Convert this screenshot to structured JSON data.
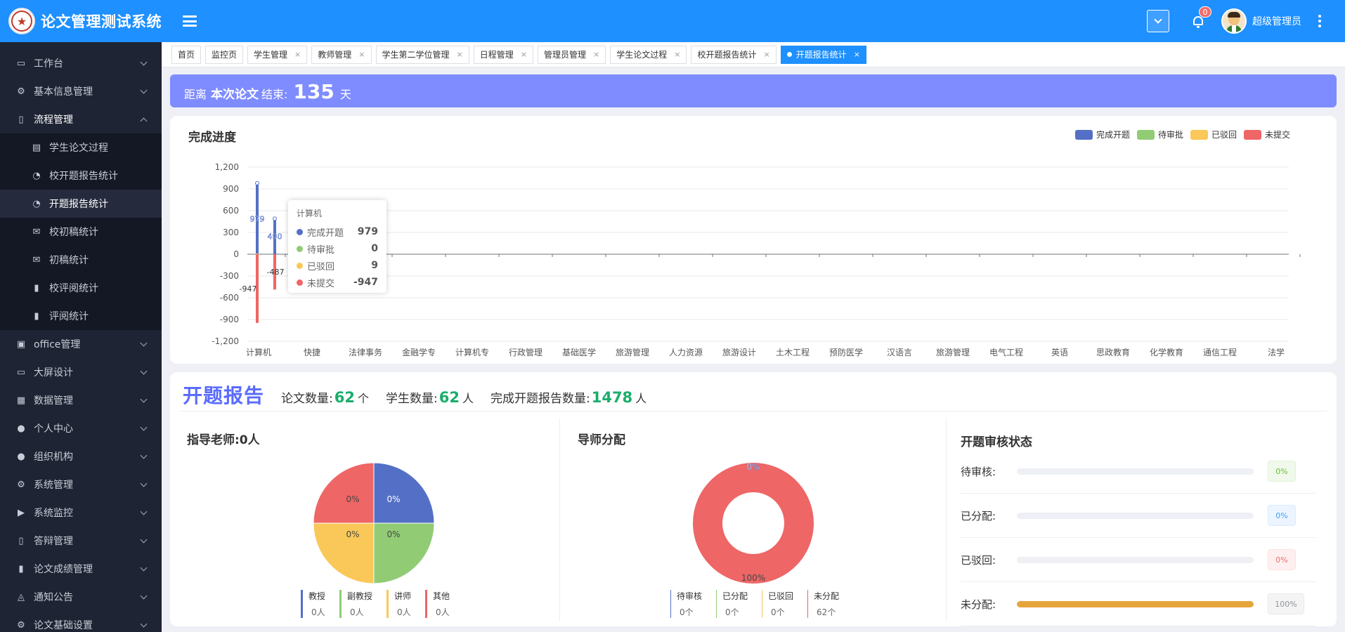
{
  "app": {
    "title": "论文管理测试系统"
  },
  "header": {
    "notifications": "0",
    "user_name": "超级管理员"
  },
  "sidebar": {
    "items": [
      {
        "label": "工作台",
        "icon": "monitor-icon",
        "glyph": "▭"
      },
      {
        "label": "基本信息管理",
        "icon": "gear-icon",
        "glyph": "⚙"
      },
      {
        "label": "流程管理",
        "icon": "document-icon",
        "glyph": "▯"
      }
    ],
    "sub_items": [
      {
        "label": "学生论文过程",
        "icon": "file-icon",
        "glyph": "▤"
      },
      {
        "label": "校开题报告统计",
        "icon": "clock-icon",
        "glyph": "◔"
      },
      {
        "label": "开题报告统计",
        "icon": "clock-icon",
        "glyph": "◔"
      },
      {
        "label": "校初稿统计",
        "icon": "message-icon",
        "glyph": "✉"
      },
      {
        "label": "初稿统计",
        "icon": "message-icon",
        "glyph": "✉"
      },
      {
        "label": "校评阅统计",
        "icon": "bar-chart-icon",
        "glyph": "▮"
      },
      {
        "label": "评阅统计",
        "icon": "bar-chart-icon",
        "glyph": "▮"
      }
    ],
    "items2": [
      {
        "label": "office管理",
        "icon": "office-icon",
        "glyph": "▣"
      },
      {
        "label": "大屏设计",
        "icon": "monitor-icon",
        "glyph": "▭"
      },
      {
        "label": "数据管理",
        "icon": "grid-icon",
        "glyph": "▦"
      },
      {
        "label": "个人中心",
        "icon": "user-icon",
        "glyph": "●"
      },
      {
        "label": "组织机构",
        "icon": "users-icon",
        "glyph": "●"
      },
      {
        "label": "系统管理",
        "icon": "cogs-icon",
        "glyph": "⚙"
      },
      {
        "label": "系统监控",
        "icon": "play-icon",
        "glyph": "▶"
      },
      {
        "label": "答辩管理",
        "icon": "document-icon",
        "glyph": "▯"
      },
      {
        "label": "论文成绩管理",
        "icon": "bar-chart-icon",
        "glyph": "▮"
      },
      {
        "label": "通知公告",
        "icon": "bell-icon",
        "glyph": "◬"
      },
      {
        "label": "论文基础设置",
        "icon": "gear-icon",
        "glyph": "⚙"
      }
    ]
  },
  "tabs": [
    {
      "label": "首页",
      "closable": false,
      "active": false
    },
    {
      "label": "监控页",
      "closable": false,
      "active": false
    },
    {
      "label": "学生管理",
      "closable": true,
      "active": false
    },
    {
      "label": "教师管理",
      "closable": true,
      "active": false
    },
    {
      "label": "学生第二学位管理",
      "closable": true,
      "active": false
    },
    {
      "label": "日程管理",
      "closable": true,
      "active": false
    },
    {
      "label": "管理员管理",
      "closable": true,
      "active": false
    },
    {
      "label": "学生论文过程",
      "closable": true,
      "active": false
    },
    {
      "label": "校开题报告统计",
      "closable": true,
      "active": false
    },
    {
      "label": "开题报告统计",
      "closable": true,
      "active": true
    }
  ],
  "countdown": {
    "prefix": "距离",
    "name": "本次论文",
    "suffix": "结束:",
    "days": "135",
    "unit": "天"
  },
  "progress_chart": {
    "title": "完成进度",
    "tooltip": {
      "category": "计算机",
      "rows": [
        {
          "label": "完成开题",
          "value": "979",
          "color": "#5470c6"
        },
        {
          "label": "待审批",
          "value": "0",
          "color": "#91cc75"
        },
        {
          "label": "已驳回",
          "value": "9",
          "color": "#fac858"
        },
        {
          "label": "未提交",
          "value": "-947",
          "color": "#ee6666"
        }
      ]
    }
  },
  "chart_data": {
    "type": "bar",
    "categories": [
      "计算机",
      "快捷",
      "法律事务",
      "金融学专",
      "计算机专",
      "行政管理",
      "基础医学",
      "旅游管理",
      "人力资源",
      "旅游设计",
      "土木工程",
      "预防医学",
      "汉语言",
      "旅游管理",
      "电气工程",
      "英语",
      "思政教育",
      "化学教育",
      "通信工程",
      "法学"
    ],
    "series": [
      {
        "name": "完成开题",
        "color": "#5470c6",
        "values": [
          979,
          490,
          0,
          0,
          0,
          0,
          0,
          0,
          0,
          0,
          0,
          0,
          0,
          0,
          0,
          0,
          0,
          0,
          0,
          0
        ]
      },
      {
        "name": "待审批",
        "color": "#91cc75",
        "values": [
          0,
          0,
          0,
          0,
          0,
          0,
          0,
          0,
          0,
          0,
          0,
          0,
          0,
          0,
          0,
          0,
          0,
          0,
          0,
          0
        ]
      },
      {
        "name": "已驳回",
        "color": "#fac858",
        "values": [
          9,
          0,
          0,
          0,
          0,
          0,
          0,
          0,
          0,
          0,
          0,
          0,
          0,
          0,
          0,
          0,
          0,
          0,
          0,
          0
        ]
      },
      {
        "name": "未提交",
        "color": "#ee6666",
        "values": [
          -947,
          -487,
          0,
          0,
          0,
          0,
          0,
          0,
          0,
          0,
          0,
          0,
          0,
          0,
          0,
          0,
          0,
          0,
          0,
          0
        ]
      }
    ],
    "data_labels": [
      {
        "category": 0,
        "series": 0,
        "text": "979"
      },
      {
        "category": 0,
        "series": 3,
        "text": "-947"
      },
      {
        "category": 1,
        "series": 0,
        "text": "490"
      },
      {
        "category": 1,
        "series": 3,
        "text": "-487"
      }
    ],
    "y_ticks": [
      1200,
      900,
      600,
      300,
      0,
      -300,
      -600,
      -900,
      -1200
    ],
    "ylim": [
      -1200,
      1200
    ],
    "grid": true,
    "legend": "top-right"
  },
  "report": {
    "title": "开题报告",
    "thesis_count_label": "论文数量:",
    "thesis_count": "62",
    "thesis_unit": "个",
    "student_count_label": "学生数量:",
    "student_count": "62",
    "student_unit": "人",
    "done_label": "完成开题报告数量:",
    "done_count": "1478",
    "done_unit": "人"
  },
  "advisor_pie": {
    "title": "指导老师:0人",
    "slices": [
      {
        "name": "教授",
        "count": "0人",
        "pct": "0%",
        "color": "#5470c6",
        "share": 0.25
      },
      {
        "name": "副教授",
        "count": "0人",
        "pct": "0%",
        "color": "#91cc75",
        "share": 0.25
      },
      {
        "name": "讲师",
        "count": "0人",
        "pct": "0%",
        "color": "#fac858",
        "share": 0.25
      },
      {
        "name": "其他",
        "count": "0人",
        "pct": "0%",
        "color": "#ee6666",
        "share": 0.25
      }
    ]
  },
  "allocation_donut": {
    "title": "导师分配",
    "top_label": "0%",
    "bottom_label": "100%",
    "slices": [
      {
        "name": "待审核",
        "count": "0个",
        "color": "#5470c6",
        "share": 0
      },
      {
        "name": "已分配",
        "count": "0个",
        "color": "#91cc75",
        "share": 0
      },
      {
        "name": "已驳回",
        "count": "0个",
        "color": "#fac858",
        "share": 0
      },
      {
        "name": "未分配",
        "count": "62个",
        "color": "#ee6666",
        "share": 1
      }
    ]
  },
  "review_status": {
    "title": "开题审核状态",
    "rows": [
      {
        "label": "待审核:",
        "pct": "0%",
        "value": 0,
        "style": "g"
      },
      {
        "label": "已分配:",
        "pct": "0%",
        "value": 0,
        "style": "b"
      },
      {
        "label": "已驳回:",
        "pct": "0%",
        "value": 0,
        "style": "r"
      },
      {
        "label": "未分配:",
        "pct": "100%",
        "value": 100,
        "style": "n"
      }
    ]
  }
}
